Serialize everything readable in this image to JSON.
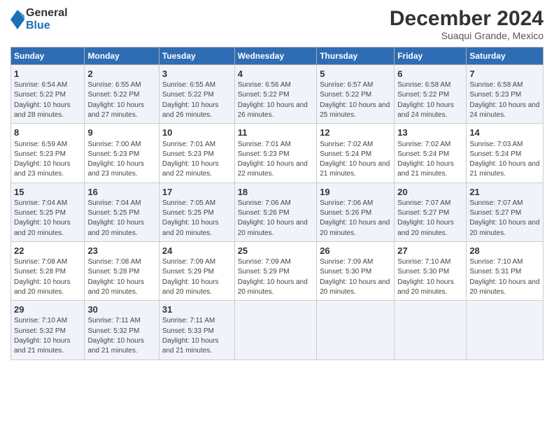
{
  "logo": {
    "general": "General",
    "blue": "Blue"
  },
  "title": "December 2024",
  "subtitle": "Suaqui Grande, Mexico",
  "days_of_week": [
    "Sunday",
    "Monday",
    "Tuesday",
    "Wednesday",
    "Thursday",
    "Friday",
    "Saturday"
  ],
  "weeks": [
    [
      {
        "day": "1",
        "sunrise": "6:54 AM",
        "sunset": "5:22 PM",
        "daylight": "10 hours and 28 minutes."
      },
      {
        "day": "2",
        "sunrise": "6:55 AM",
        "sunset": "5:22 PM",
        "daylight": "10 hours and 27 minutes."
      },
      {
        "day": "3",
        "sunrise": "6:55 AM",
        "sunset": "5:22 PM",
        "daylight": "10 hours and 26 minutes."
      },
      {
        "day": "4",
        "sunrise": "6:56 AM",
        "sunset": "5:22 PM",
        "daylight": "10 hours and 26 minutes."
      },
      {
        "day": "5",
        "sunrise": "6:57 AM",
        "sunset": "5:22 PM",
        "daylight": "10 hours and 25 minutes."
      },
      {
        "day": "6",
        "sunrise": "6:58 AM",
        "sunset": "5:22 PM",
        "daylight": "10 hours and 24 minutes."
      },
      {
        "day": "7",
        "sunrise": "6:58 AM",
        "sunset": "5:23 PM",
        "daylight": "10 hours and 24 minutes."
      }
    ],
    [
      {
        "day": "8",
        "sunrise": "6:59 AM",
        "sunset": "5:23 PM",
        "daylight": "10 hours and 23 minutes."
      },
      {
        "day": "9",
        "sunrise": "7:00 AM",
        "sunset": "5:23 PM",
        "daylight": "10 hours and 23 minutes."
      },
      {
        "day": "10",
        "sunrise": "7:01 AM",
        "sunset": "5:23 PM",
        "daylight": "10 hours and 22 minutes."
      },
      {
        "day": "11",
        "sunrise": "7:01 AM",
        "sunset": "5:23 PM",
        "daylight": "10 hours and 22 minutes."
      },
      {
        "day": "12",
        "sunrise": "7:02 AM",
        "sunset": "5:24 PM",
        "daylight": "10 hours and 21 minutes."
      },
      {
        "day": "13",
        "sunrise": "7:02 AM",
        "sunset": "5:24 PM",
        "daylight": "10 hours and 21 minutes."
      },
      {
        "day": "14",
        "sunrise": "7:03 AM",
        "sunset": "5:24 PM",
        "daylight": "10 hours and 21 minutes."
      }
    ],
    [
      {
        "day": "15",
        "sunrise": "7:04 AM",
        "sunset": "5:25 PM",
        "daylight": "10 hours and 20 minutes."
      },
      {
        "day": "16",
        "sunrise": "7:04 AM",
        "sunset": "5:25 PM",
        "daylight": "10 hours and 20 minutes."
      },
      {
        "day": "17",
        "sunrise": "7:05 AM",
        "sunset": "5:25 PM",
        "daylight": "10 hours and 20 minutes."
      },
      {
        "day": "18",
        "sunrise": "7:06 AM",
        "sunset": "5:26 PM",
        "daylight": "10 hours and 20 minutes."
      },
      {
        "day": "19",
        "sunrise": "7:06 AM",
        "sunset": "5:26 PM",
        "daylight": "10 hours and 20 minutes."
      },
      {
        "day": "20",
        "sunrise": "7:07 AM",
        "sunset": "5:27 PM",
        "daylight": "10 hours and 20 minutes."
      },
      {
        "day": "21",
        "sunrise": "7:07 AM",
        "sunset": "5:27 PM",
        "daylight": "10 hours and 20 minutes."
      }
    ],
    [
      {
        "day": "22",
        "sunrise": "7:08 AM",
        "sunset": "5:28 PM",
        "daylight": "10 hours and 20 minutes."
      },
      {
        "day": "23",
        "sunrise": "7:08 AM",
        "sunset": "5:28 PM",
        "daylight": "10 hours and 20 minutes."
      },
      {
        "day": "24",
        "sunrise": "7:09 AM",
        "sunset": "5:29 PM",
        "daylight": "10 hours and 20 minutes."
      },
      {
        "day": "25",
        "sunrise": "7:09 AM",
        "sunset": "5:29 PM",
        "daylight": "10 hours and 20 minutes."
      },
      {
        "day": "26",
        "sunrise": "7:09 AM",
        "sunset": "5:30 PM",
        "daylight": "10 hours and 20 minutes."
      },
      {
        "day": "27",
        "sunrise": "7:10 AM",
        "sunset": "5:30 PM",
        "daylight": "10 hours and 20 minutes."
      },
      {
        "day": "28",
        "sunrise": "7:10 AM",
        "sunset": "5:31 PM",
        "daylight": "10 hours and 20 minutes."
      }
    ],
    [
      {
        "day": "29",
        "sunrise": "7:10 AM",
        "sunset": "5:32 PM",
        "daylight": "10 hours and 21 minutes."
      },
      {
        "day": "30",
        "sunrise": "7:11 AM",
        "sunset": "5:32 PM",
        "daylight": "10 hours and 21 minutes."
      },
      {
        "day": "31",
        "sunrise": "7:11 AM",
        "sunset": "5:33 PM",
        "daylight": "10 hours and 21 minutes."
      },
      null,
      null,
      null,
      null
    ]
  ]
}
